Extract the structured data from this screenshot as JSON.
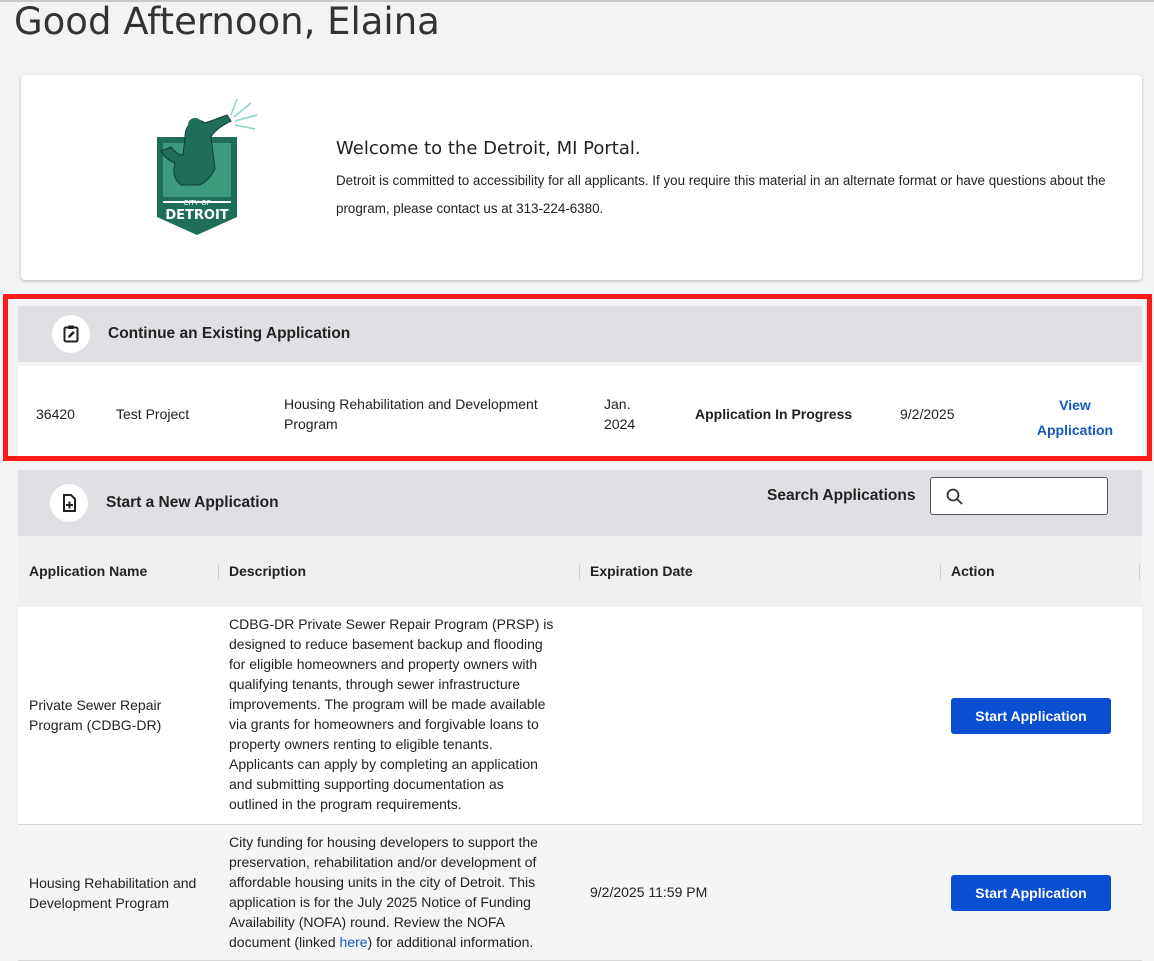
{
  "greeting": "Good Afternoon, Elaina",
  "welcome": {
    "title": "Welcome to the Detroit, MI Portal.",
    "body": "Detroit is committed to accessibility for all applicants. If you require this material in an alternate format or have questions about the program, please contact us at 313-224-6380.",
    "logo": {
      "top_text": "CITY OF",
      "bottom_text": "DETROIT"
    }
  },
  "existing": {
    "header": "Continue an Existing Application",
    "icon": "clipboard-edit-icon",
    "row": {
      "id": "36420",
      "project": "Test Project",
      "program_line1": "Housing Rehabilitation and Development",
      "program_line2": "Program",
      "date_line1": "Jan.",
      "date_line2": "2024",
      "status": "Application In Progress",
      "due": "9/2/2025",
      "action_line1": "View",
      "action_line2": "Application"
    }
  },
  "new_app": {
    "header": "Start a New Application",
    "icon": "file-add-icon",
    "search_label": "Search Applications",
    "search_icon": "search-icon",
    "search_value": ""
  },
  "table": {
    "headers": [
      "Application Name",
      "Description",
      "Expiration Date",
      "Action"
    ],
    "rows": [
      {
        "name_line1": "Private Sewer Repair",
        "name_line2": "Program (CDBG-DR)",
        "description": [
          "CDBG-DR Private Sewer Repair Program (PRSP) is",
          "designed to reduce basement backup and flooding",
          "for eligible homeowners and property owners with",
          "qualifying tenants, through sewer infrastructure",
          "improvements. The program will be made available",
          "via grants for homeowners and forgivable loans to",
          "property owners renting to eligible tenants.",
          "Applicants can apply by completing an application",
          "and submitting supporting documentation as",
          "outlined in the program requirements."
        ],
        "expiration": "",
        "action": "Start Application"
      },
      {
        "name_line1": "Housing Rehabilitation and",
        "name_line2": "Development Program",
        "description": [
          "City funding for housing developers to support the",
          "preservation, rehabilitation and/or development of",
          "affordable housing units in the city of Detroit. This",
          "application is for the July 2025 Notice of Funding",
          "Availability (NOFA) round. Review the NOFA"
        ],
        "description_last_pre": "document (linked ",
        "description_last_link": "here",
        "description_last_post": ") for additional information.",
        "expiration": "9/2/2025 11:59 PM",
        "action": "Start Application"
      }
    ]
  },
  "colors": {
    "accent": "#0a4fd1",
    "highlight": "#ff1a1a",
    "logo_green": "#1f6e5a"
  }
}
